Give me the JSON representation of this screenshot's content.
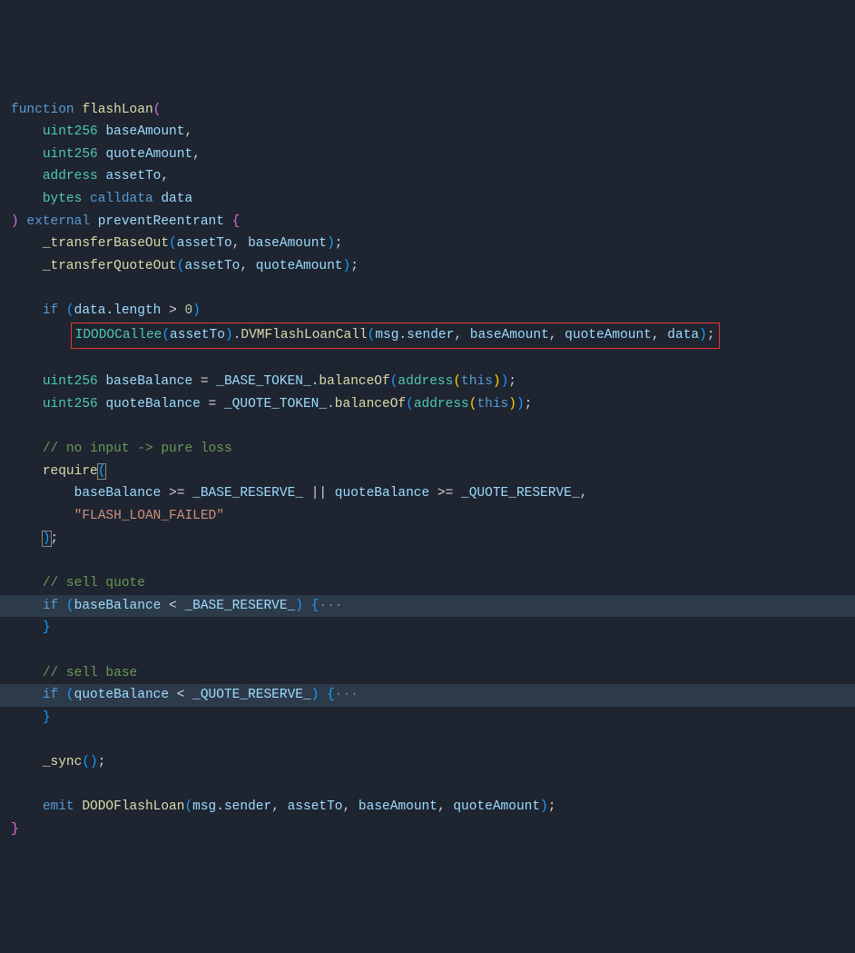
{
  "code": {
    "fn_kw": "function",
    "fn_name": "flashLoan",
    "param1_type": "uint256",
    "param1_name": "baseAmount",
    "param2_type": "uint256",
    "param2_name": "quoteAmount",
    "param3_type": "address",
    "param3_name": "assetTo",
    "param4_type": "bytes",
    "param4_mod": "calldata",
    "param4_name": "data",
    "visibility": "external",
    "modifier": "preventReentrant",
    "transferBase": "_transferBaseOut",
    "transferQuote": "_transferQuoteOut",
    "if_kw": "if",
    "data_len": "data",
    "length_prop": "length",
    "gt": ">",
    "zero": "0",
    "idodo": "IDODOCallee",
    "dvmcall": "DVMFlashLoanCall",
    "msg": "msg",
    "sender": "sender",
    "baseBalance": "baseBalance",
    "quoteBalance": "quoteBalance",
    "baseToken": "_BASE_TOKEN_",
    "quoteToken": "_QUOTE_TOKEN_",
    "balanceOf": "balanceOf",
    "address_cast": "address",
    "this_kw": "this",
    "comment_noinput": "// no input -> pure loss",
    "require_kw": "require",
    "baseReserve": "_BASE_RESERVE_",
    "quoteReserve": "_QUOTE_RESERVE_",
    "gte": ">=",
    "or": "||",
    "flash_fail": "\"FLASH_LOAN_FAILED\"",
    "comment_sellquote": "// sell quote",
    "comment_sellbase": "// sell base",
    "lt": "<",
    "fold_marker": "···",
    "sync": "_sync",
    "emit_kw": "emit",
    "event_name": "DODOFlashLoan",
    "eq": " = ",
    "comma": ","
  }
}
